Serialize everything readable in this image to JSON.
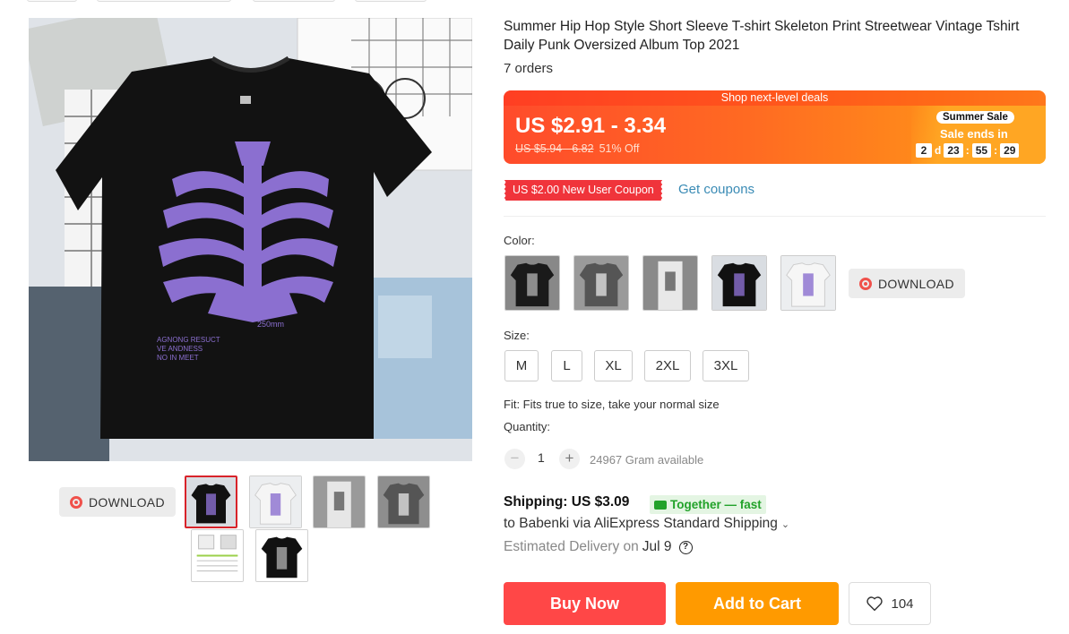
{
  "product": {
    "title": "Summer Hip Hop Style Short Sleeve T-shirt Skeleton Print Streetwear Vintage Tshirt Daily Punk Oversized Album Top 2021",
    "orders": "7 orders",
    "image_text": {
      "size_mark": "250mm",
      "line1": "AGNONG RESUCT",
      "line2": "VE ANDNESS",
      "line3": "NO IN MEET"
    }
  },
  "deal": {
    "banner": "Shop next-level deals",
    "price": "US $2.91 - 3.34",
    "old_price": "US $5.94 - 6.82",
    "discount": "51% Off",
    "sale_badge": "Summer Sale",
    "sale_ends": "Sale ends in",
    "timer": {
      "days": "2",
      "d_label": "d",
      "hours": "23",
      "minutes": "55",
      "seconds": "29",
      "sep": ":"
    }
  },
  "coupon": {
    "label": "US $2.00 New User Coupon",
    "get_coupons": "Get coupons"
  },
  "options": {
    "color_label": "Color:",
    "size_label": "Size:",
    "sizes": [
      "M",
      "L",
      "XL",
      "2XL",
      "3XL"
    ],
    "fit": "Fit: Fits true to size, take your normal size",
    "quantity_label": "Quantity:",
    "quantity": "1",
    "minus": "−",
    "plus": "+",
    "available": "24967 Gram available"
  },
  "download": {
    "label": "DOWNLOAD"
  },
  "shipping": {
    "title": "Shipping: US $3.09",
    "together": "Together — fast",
    "to": "to Babenki via AliExpress Standard Shipping",
    "chevron": "⌄",
    "estimated": "Estimated Delivery on",
    "date": "Jul 9",
    "help": "?"
  },
  "actions": {
    "buy_now": "Buy Now",
    "add_to_cart": "Add to Cart",
    "wishlist_count": "104"
  },
  "colors": {
    "accent_red": "#ff4747",
    "cart_orange": "#ff9a00",
    "coupon_red": "#f0343b",
    "link_blue": "#3a8bb5",
    "print_purple": "#8b6fd0"
  }
}
